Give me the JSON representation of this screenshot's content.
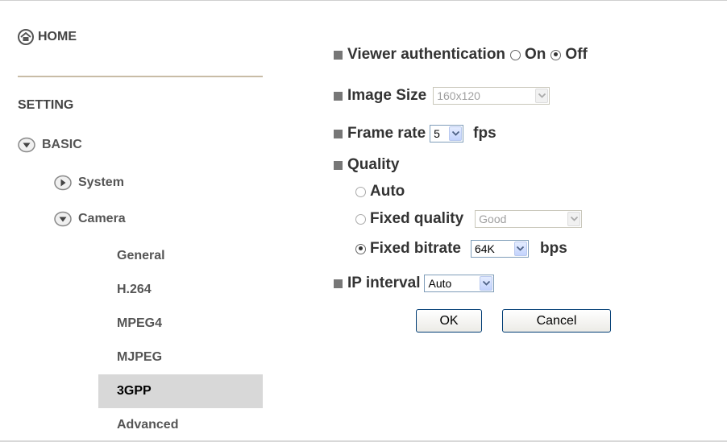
{
  "sidebar": {
    "home_label": "HOME",
    "section_label": "SETTING",
    "basic_label": "BASIC",
    "system_label": "System",
    "camera_label": "Camera",
    "camera_items": [
      {
        "label": "General"
      },
      {
        "label": "H.264"
      },
      {
        "label": "MPEG4"
      },
      {
        "label": "MJPEG"
      },
      {
        "label": "3GPP",
        "active": true
      },
      {
        "label": "Advanced"
      }
    ]
  },
  "form": {
    "viewer_auth": {
      "label": "Viewer authentication",
      "on_label": "On",
      "off_label": "Off",
      "selected": "Off"
    },
    "image_size": {
      "label": "Image Size",
      "value": "160x120"
    },
    "frame_rate": {
      "label": "Frame rate",
      "value": "5",
      "unit": "fps"
    },
    "quality": {
      "label": "Quality",
      "auto_label": "Auto",
      "fixed_quality_label": "Fixed quality",
      "fixed_quality_value": "Good",
      "fixed_bitrate_label": "Fixed bitrate",
      "fixed_bitrate_value": "64K",
      "bitrate_unit": "bps",
      "selected": "Fixed bitrate"
    },
    "ip_interval": {
      "label": "IP interval",
      "value": "Auto"
    },
    "ok_label": "OK",
    "cancel_label": "Cancel"
  },
  "colors": {
    "active_bg": "#d8d8d8",
    "select_border": "#7f9db9",
    "button_border": "#003c74"
  }
}
